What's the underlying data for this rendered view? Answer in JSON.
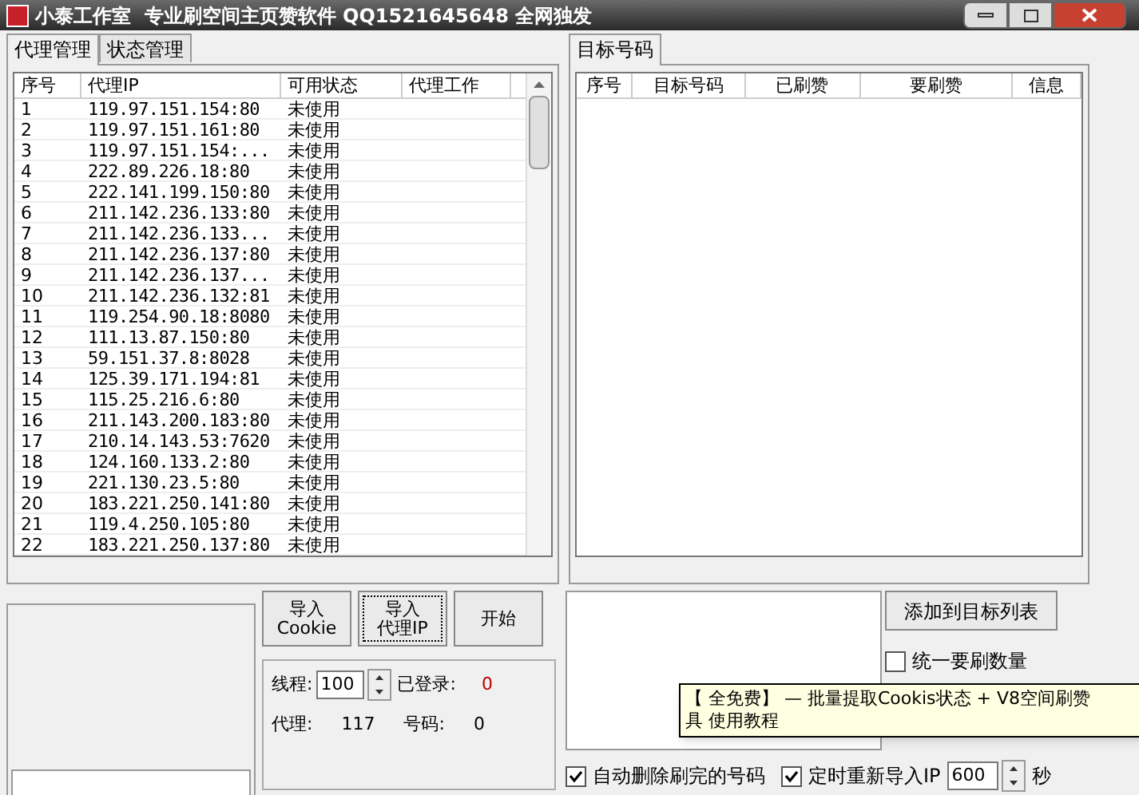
{
  "window": {
    "title": "小泰工作室  专业刷空间主页赞软件 QQ1521645648 全网独发"
  },
  "left_tabs": [
    {
      "label": "代理管理",
      "selected": true
    },
    {
      "label": "状态管理",
      "selected": false
    }
  ],
  "proxy_table": {
    "columns": [
      "序号",
      "代理IP",
      "可用状态",
      "代理工作"
    ],
    "rows": [
      [
        "1",
        "119.97.151.154:80",
        "未使用"
      ],
      [
        "2",
        "119.97.151.161:80",
        "未使用"
      ],
      [
        "3",
        "119.97.151.154:...",
        "未使用"
      ],
      [
        "4",
        "222.89.226.18:80",
        "未使用"
      ],
      [
        "5",
        "222.141.199.150:80",
        "未使用"
      ],
      [
        "6",
        "211.142.236.133:80",
        "未使用"
      ],
      [
        "7",
        "211.142.236.133...",
        "未使用"
      ],
      [
        "8",
        "211.142.236.137:80",
        "未使用"
      ],
      [
        "9",
        "211.142.236.137...",
        "未使用"
      ],
      [
        "10",
        "211.142.236.132:81",
        "未使用"
      ],
      [
        "11",
        "119.254.90.18:8080",
        "未使用"
      ],
      [
        "12",
        "111.13.87.150:80",
        "未使用"
      ],
      [
        "13",
        "59.151.37.8:8028",
        "未使用"
      ],
      [
        "14",
        "125.39.171.194:81",
        "未使用"
      ],
      [
        "15",
        "115.25.216.6:80",
        "未使用"
      ],
      [
        "16",
        "211.143.200.183:80",
        "未使用"
      ],
      [
        "17",
        "210.14.143.53:7620",
        "未使用"
      ],
      [
        "18",
        "124.160.133.2:80",
        "未使用"
      ],
      [
        "19",
        "221.130.23.5:80",
        "未使用"
      ],
      [
        "20",
        "183.221.250.141:80",
        "未使用"
      ],
      [
        "21",
        "119.4.250.105:80",
        "未使用"
      ],
      [
        "22",
        "183.221.250.137:80",
        "未使用"
      ]
    ]
  },
  "right_tabs": [
    {
      "label": "目标号码",
      "selected": true
    }
  ],
  "target_table": {
    "columns": [
      "序号",
      "目标号码",
      "已刷赞",
      "要刷赞",
      "信息"
    ]
  },
  "buttons": [
    {
      "lines": [
        "导入",
        "Cookie"
      ],
      "focused": false
    },
    {
      "lines": [
        "导入",
        "代理IP"
      ],
      "focused": true
    },
    {
      "lines": [
        "开始"
      ],
      "focused": false
    }
  ],
  "stats": {
    "threads_label": "线程:",
    "threads_value": "100",
    "logged_in_label": "已登录:",
    "logged_in_value": "0",
    "proxy_label": "代理:",
    "proxy_value": "117",
    "numbers_label": "号码:",
    "numbers_value": "0"
  },
  "add_button": "添加到目标列表",
  "unify_checkbox": {
    "label": "统一要刷数量",
    "checked": false
  },
  "tooltip": {
    "lines": [
      "【 全免费】 — 批量提取Cookis状态 + V8空间刷赞",
      "具 使用教程"
    ]
  },
  "bottom_options": [
    {
      "label": "自动删除刷完的号码",
      "checked": true
    },
    {
      "label": "定时重新导入IP",
      "checked": true
    }
  ],
  "reimport": {
    "value": "600",
    "unit": "秒"
  }
}
